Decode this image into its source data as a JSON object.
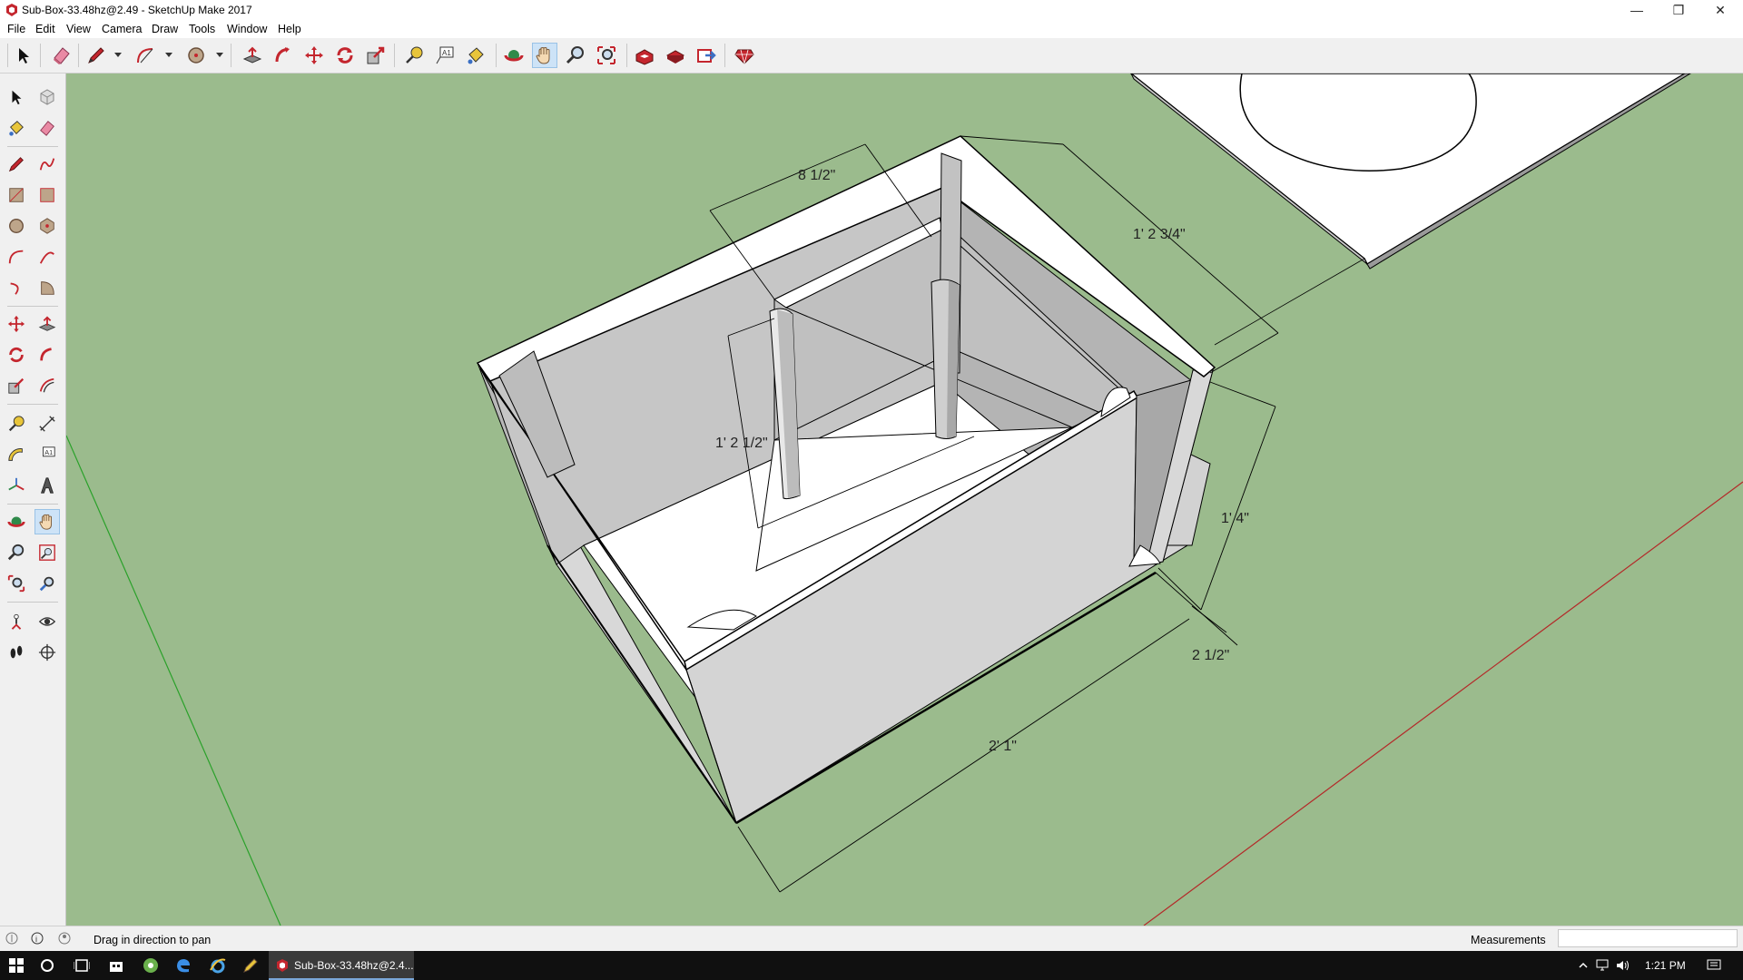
{
  "window": {
    "title": "Sub-Box-33.48hz@2.49 - SketchUp Make 2017",
    "controls": [
      "minimize",
      "restore",
      "close"
    ]
  },
  "menu": [
    "File",
    "Edit",
    "View",
    "Camera",
    "Draw",
    "Tools",
    "Window",
    "Help"
  ],
  "toolbar": {
    "buttons": [
      "select-icon",
      "eraser-icon",
      "pencil-icon",
      "arc-icon",
      "circle-icon",
      "push-pull-icon",
      "follow-me-icon",
      "move-icon",
      "rotate-icon",
      "scale-icon",
      "tape-measure-icon",
      "text-icon",
      "paint-bucket-icon",
      "orbit-icon",
      "pan-icon",
      "zoom-icon",
      "zoom-extents-icon",
      "warehouse-icon",
      "extension-icon",
      "share-model-icon",
      "ruby-icon"
    ],
    "active": "pan-icon"
  },
  "left_toolbar": {
    "active": "pan-icon"
  },
  "dimensions": {
    "top_width": "8 1/2\"",
    "depth_top": "1' 2 3/4\"",
    "inner_height": "1' 2 1/2\"",
    "height": "1' 4\"",
    "thickness": "2 1/2\"",
    "length": "2' 1\""
  },
  "status": {
    "hint": "Drag in direction to pan",
    "measurements_label": "Measurements",
    "measurements_value": ""
  },
  "taskbar": {
    "app_label": "Sub-Box-33.48hz@2.4...",
    "time": "1:21 PM"
  },
  "colors": {
    "ground": "#9bbb8d",
    "accent": "#cde3f7",
    "app_red": "#c4262e"
  }
}
